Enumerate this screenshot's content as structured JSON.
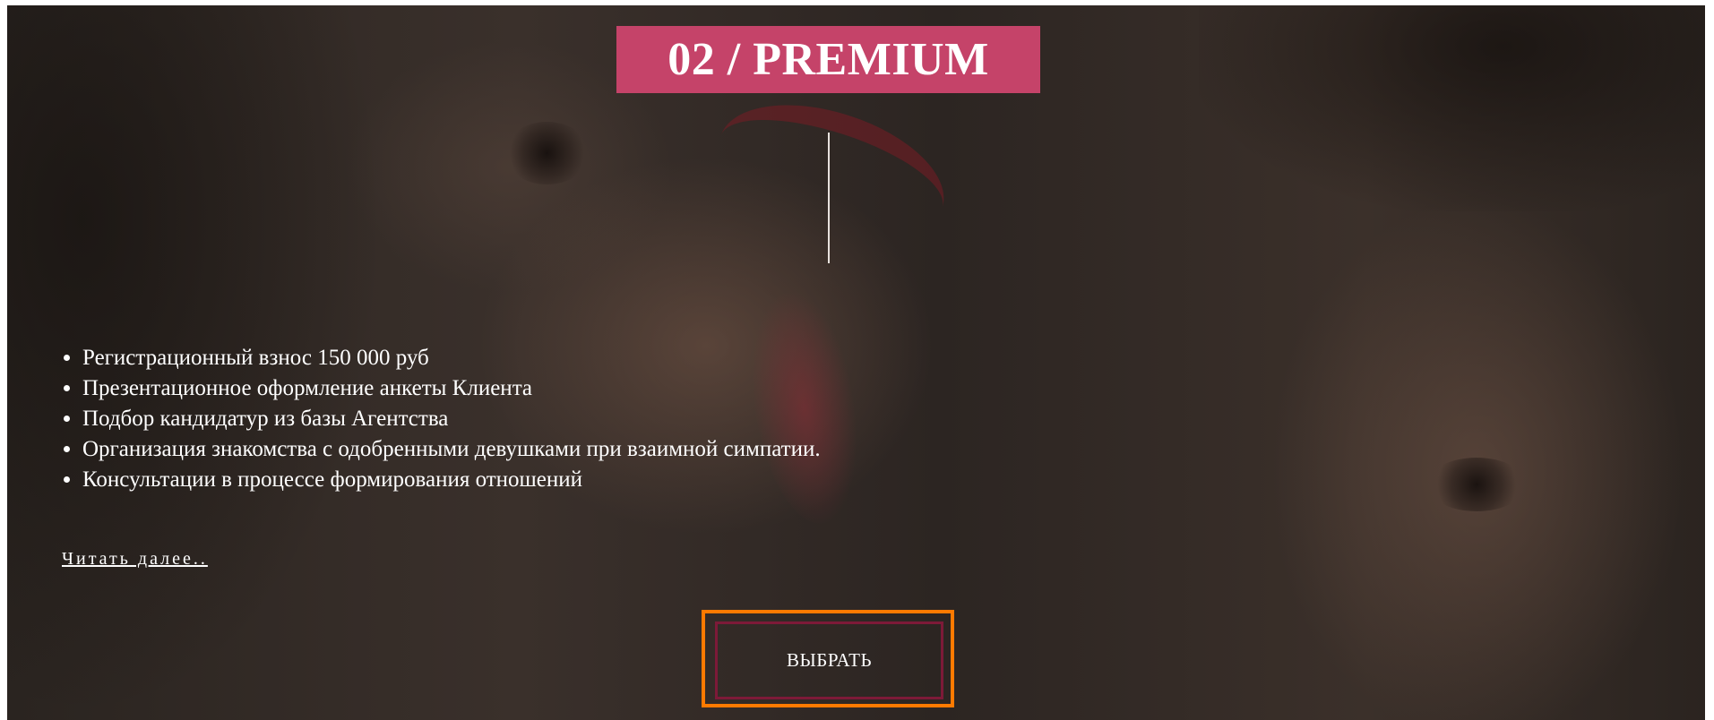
{
  "plan": {
    "title": "02 / PREMIUM",
    "features": [
      "Регистрационный взнос 150 000 руб",
      "Презентационное оформление анкеты Клиента",
      "Подбор кандидатур из базы Агентства",
      "Организация знакомства с одобренными девушками при взаимной симпатии.",
      "Консультации в процессе формирования отношений"
    ],
    "read_more_label": "Читать далее..",
    "choose_label": "ВЫБРАТЬ"
  },
  "colors": {
    "title_bg": "#c54369",
    "button_border": "#7d1a38",
    "focus_outline": "#ff7a00"
  }
}
